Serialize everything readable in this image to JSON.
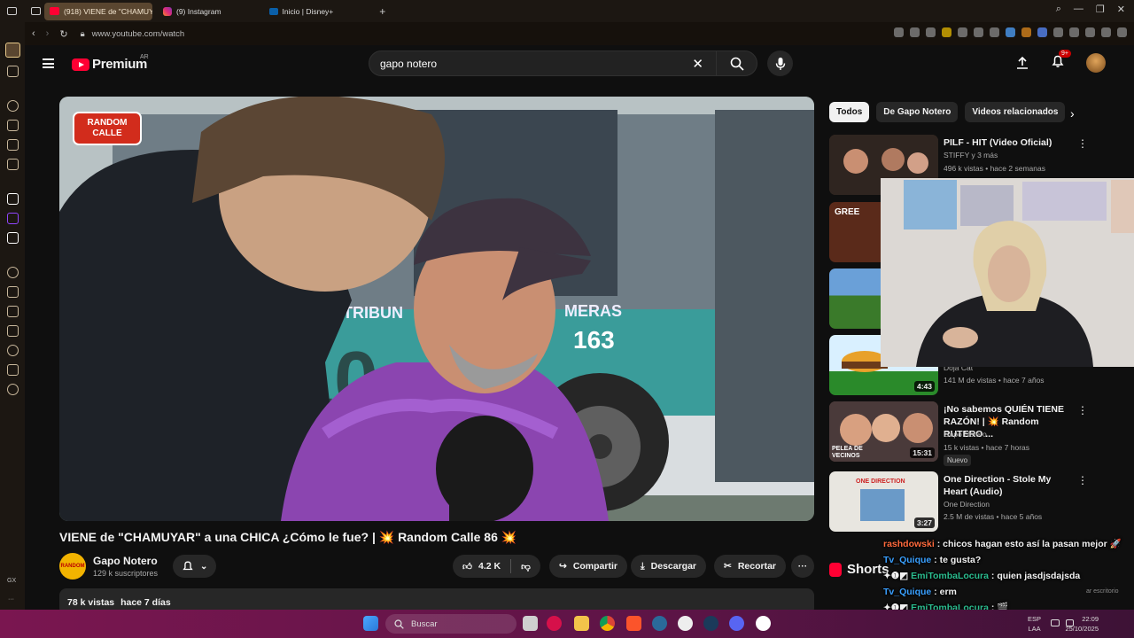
{
  "browser": {
    "tabs": [
      {
        "label": "(918) VIENE de \"CHAMUY",
        "color": "#ff0033"
      },
      {
        "label": "(9) Instagram",
        "color": "#d6249f"
      },
      {
        "label": "Inicio | Disney+",
        "color": "#0a5fa8"
      }
    ],
    "new_tab": "+",
    "url": "www.youtube.com/watch",
    "sidebar_label": "GX",
    "sidebar_more": "···"
  },
  "youtube": {
    "logo": "Premium",
    "logo_region": "AR",
    "search_value": "gapo notero",
    "notification_count": "9+",
    "video": {
      "bus_text": "TRIBUN",
      "bus_text2": "MERAS",
      "bus_number": "163",
      "bus_side": "10",
      "sign": "RANDOM CALLE",
      "title": "VIENE de \"CHAMUYAR\" a una CHICA ¿Cómo le fue? | 💥 Random Calle 86 💥",
      "channel": "Gapo Notero",
      "subscribers": "129 k suscriptores",
      "likes": "4.2 K",
      "share": "Compartir",
      "download": "Descargar",
      "clip": "Recortar",
      "views": "78 k vistas",
      "age": "hace 7 días"
    },
    "chips": [
      "Todos",
      "De Gapo Notero",
      "Videos relacionados"
    ],
    "recommendations": [
      {
        "title": "PILF - HIT (Video Oficial)",
        "channel": "STIFFY y 3 más",
        "meta": "496 k vistas • hace 2 semanas",
        "duration": "",
        "thumb": "#3a2a22",
        "thumb_text": ""
      },
      {
        "title": "",
        "channel": "",
        "meta": "",
        "duration": "",
        "thumb": "#5a2a1a",
        "thumb_text": "GREE"
      },
      {
        "title": "",
        "channel": "",
        "meta": "",
        "duration": "",
        "thumb": "#3a6a2a",
        "thumb_text": ""
      },
      {
        "title": "",
        "channel": "Doja Cat",
        "meta": "141 M de vistas • hace 7 años",
        "duration": "4:43",
        "thumb": "#2a8a2a",
        "thumb_text": ""
      },
      {
        "title": "¡No sabemos QUIÉN TIENE RAZÓN! | 💥 Random RUTERO ...",
        "channel": "Gapo Notero",
        "meta": "15 k vistas • hace 7 horas",
        "duration": "15:31",
        "thumb": "#6a4a3a",
        "thumb_text": "PELEA DE VECINOS",
        "badge": "Nuevo"
      },
      {
        "title": "One Direction - Stole My Heart (Audio)",
        "channel": "One Direction",
        "meta": "2.5 M de vistas • hace 5 años",
        "duration": "3:27",
        "thumb": "#e8e6e0",
        "thumb_text": "ONE DIRECTION"
      }
    ],
    "shorts": "Shorts"
  },
  "chat": [
    {
      "user": "rashdowski",
      "text": "chicos hagan esto así la pasan mejor 🚀"
    },
    {
      "user": "Tv_Quique",
      "text": "te gusta?"
    },
    {
      "user": "EmiTombaLocura",
      "text": "quien jasdjsdajsda"
    },
    {
      "user": "Tv_Quique",
      "text": "erm"
    },
    {
      "user": "EmiTombaLocura",
      "text": "🎬"
    }
  ],
  "taskbar": {
    "search": "Buscar",
    "lang": "ESP",
    "lang2": "LAA",
    "time": "22:09",
    "date": "25/10/2025",
    "desktop": "ar escritorio"
  }
}
